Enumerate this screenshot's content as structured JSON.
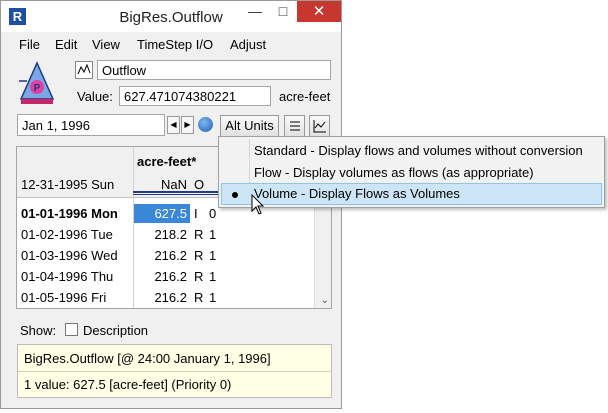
{
  "window": {
    "title": "BigRes.Outflow",
    "menu": [
      "File",
      "Edit",
      "View",
      "TimeStep I/O",
      "Adjust"
    ]
  },
  "header": {
    "name_value": "Outflow",
    "value_label": "Value:",
    "value": "627.471074380221",
    "units": "acre-feet"
  },
  "toolbar": {
    "date": "Jan 1, 1996",
    "alt_units_label": "Alt Units"
  },
  "grid": {
    "column_header": "acre-feet*",
    "rows": [
      {
        "date": "12-31-1995 Sun",
        "value": "NaN",
        "flag": "O",
        "prio": ""
      },
      {
        "date": "01-01-1996 Mon",
        "value": "627.5",
        "flag": "I",
        "prio": "0"
      },
      {
        "date": "01-02-1996 Tue",
        "value": "218.2",
        "flag": "R",
        "prio": "1"
      },
      {
        "date": "01-03-1996 Wed",
        "value": "216.2",
        "flag": "R",
        "prio": "1"
      },
      {
        "date": "01-04-1996 Thu",
        "value": "216.2",
        "flag": "R",
        "prio": "1"
      },
      {
        "date": "01-05-1996 Fri",
        "value": "216.2",
        "flag": "R",
        "prio": "1"
      }
    ]
  },
  "show": {
    "label": "Show:",
    "description_label": "Description"
  },
  "info": {
    "line1": "BigRes.Outflow [@ 24:00 January 1, 1996]",
    "line2": "1 value:  627.5 [acre-feet]  (Priority 0)"
  },
  "popup": {
    "items": [
      {
        "label": "Standard - Display flows and volumes without conversion"
      },
      {
        "label": "Flow - Display volumes as flows (as appropriate)"
      },
      {
        "label": "Volume - Display Flows as Volumes"
      }
    ]
  },
  "colors": {
    "selection": "#3a87d8",
    "close_button": "#c7372f",
    "info_background": "#ffffe6"
  }
}
